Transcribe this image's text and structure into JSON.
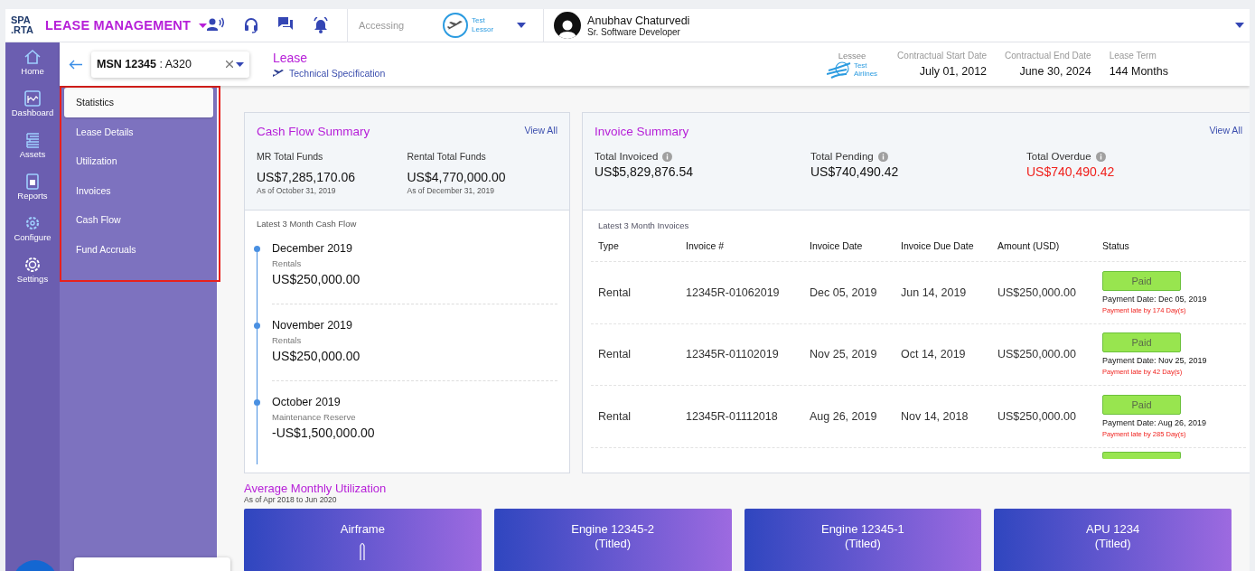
{
  "app": {
    "logo_top": "SPA",
    "logo_bottom": ".RTA",
    "title": "LEASE MANAGEMENT"
  },
  "accessing": {
    "label": "Accessing",
    "company_line1": "Test",
    "company_line2": "Lessor"
  },
  "user": {
    "name": "Anubhav Chaturvedi",
    "role": "Sr. Software Developer"
  },
  "rail": [
    {
      "kind": "home",
      "label": "Home"
    },
    {
      "kind": "dashboard",
      "label": "Dashboard"
    },
    {
      "kind": "assets",
      "label": "Assets"
    },
    {
      "kind": "reports",
      "label": "Reports"
    },
    {
      "kind": "configure",
      "label": "Configure"
    },
    {
      "kind": "settings",
      "label": "Settings"
    }
  ],
  "submenu": [
    {
      "label": "Statistics",
      "selected": true
    },
    {
      "label": "Lease Details",
      "selected": false
    },
    {
      "label": "Utilization",
      "selected": false
    },
    {
      "label": "Invoices",
      "selected": false
    },
    {
      "label": "Cash Flow",
      "selected": false
    },
    {
      "label": "Fund Accruals",
      "selected": false
    }
  ],
  "asset_selector": {
    "value": "**MSN 12345** : A320"
  },
  "lease_header": {
    "title": "Lease",
    "link": "Technical Specification",
    "lessee_label": "Lessee",
    "lessee_line1": "Test",
    "lessee_line2": "Airlines",
    "facts": [
      {
        "label": "Contractual Start Date",
        "value": "July 01, 2012"
      },
      {
        "label": "Contractual End Date",
        "value": "June 30, 2024"
      },
      {
        "label": "Lease Term",
        "value": "144 Months"
      }
    ]
  },
  "cash_flow": {
    "title": "Cash Flow Summary",
    "view_all": "View All",
    "funds": [
      {
        "label": "MR Total Funds",
        "value": "US$7,285,170.06",
        "as_of": "As of October 31, 2019"
      },
      {
        "label": "Rental Total Funds",
        "value": "US$4,770,000.00",
        "as_of": "As of December 31, 2019"
      }
    ],
    "timeline_title": "Latest 3 Month Cash Flow",
    "timeline": [
      {
        "month": "December 2019",
        "type": "Rentals",
        "amount": "US$250,000.00"
      },
      {
        "month": "November 2019",
        "type": "Rentals",
        "amount": "US$250,000.00"
      },
      {
        "month": "October 2019",
        "type": "Maintenance Reserve",
        "amount": "-US$1,500,000.00"
      }
    ]
  },
  "invoice_summary": {
    "title": "Invoice Summary",
    "view_all": "View All",
    "totals": [
      {
        "label": "Total Invoiced",
        "value": "US$5,829,876.54",
        "overdue": false
      },
      {
        "label": "Total Pending",
        "value": "US$740,490.42",
        "overdue": false
      },
      {
        "label": "Total Overdue",
        "value": "US$740,490.42",
        "overdue": true
      }
    ],
    "table_title": "Latest 3 Month Invoices",
    "columns": [
      "Type",
      "Invoice #",
      "Invoice Date",
      "Invoice Due Date",
      "Amount (USD)",
      "Status"
    ],
    "rows": [
      {
        "type": "Rental",
        "number": "12345R-01062019",
        "date": "Dec 05, 2019",
        "due": "Jun 14, 2019",
        "amount": "US$250,000.00",
        "status": "Paid",
        "payment_date": "Payment Date: Dec 05, 2019",
        "late_note": "Payment late by 174 Day(s)"
      },
      {
        "type": "Rental",
        "number": "12345R-01102019",
        "date": "Nov 25, 2019",
        "due": "Oct 14, 2019",
        "amount": "US$250,000.00",
        "status": "Paid",
        "payment_date": "Payment Date: Nov 25, 2019",
        "late_note": "Payment late by 42 Day(s)"
      },
      {
        "type": "Rental",
        "number": "12345R-01112018",
        "date": "Aug 26, 2019",
        "due": "Nov 14, 2018",
        "amount": "US$250,000.00",
        "status": "Paid",
        "payment_date": "Payment Date: Aug 26, 2019",
        "late_note": "Payment late by 285 Day(s)"
      }
    ]
  },
  "utilization": {
    "title": "Average Monthly Utilization",
    "subtitle": "As of Apr 2018 to Jun 2020",
    "cards": [
      {
        "kind": "airframe",
        "name": "Airframe"
      },
      {
        "kind": "engine",
        "name": "Engine 12345-2",
        "note": "(Titled)"
      },
      {
        "kind": "engine",
        "name": "Engine 12345-1",
        "note": "(Titled)"
      },
      {
        "kind": "apu",
        "name": "APU 1234",
        "note": "(Titled)"
      }
    ]
  }
}
